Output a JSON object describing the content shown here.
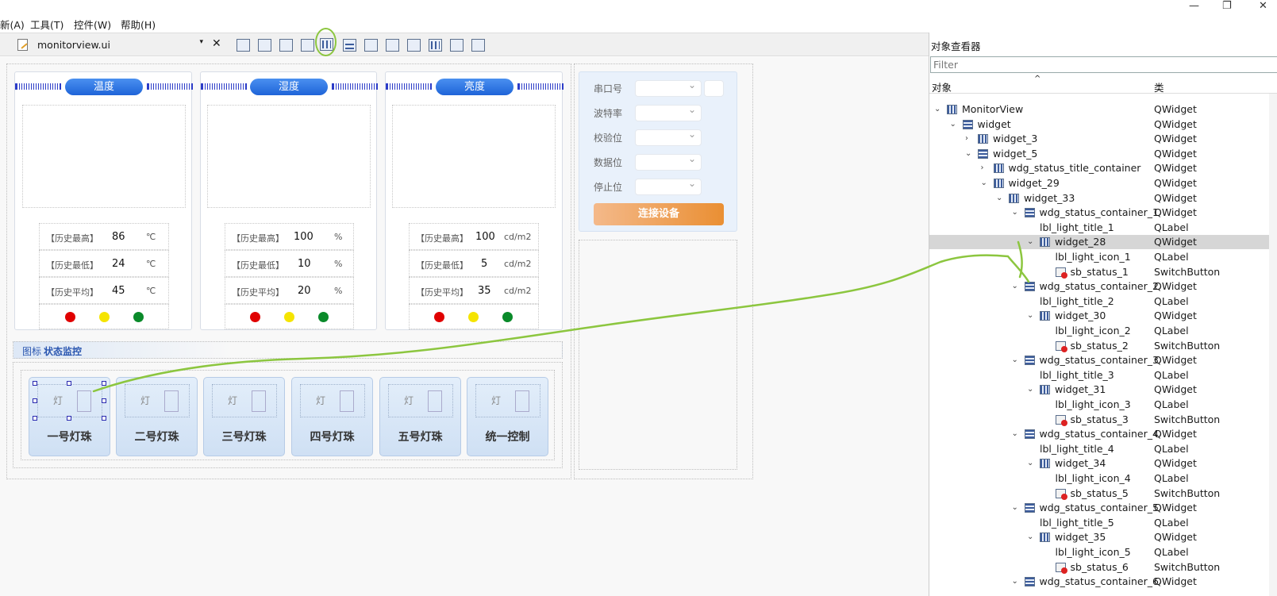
{
  "menu": {
    "items": [
      "新(A)",
      "工具(T)",
      "控件(W)",
      "帮助(H)"
    ]
  },
  "window_controls": {
    "minimize": "—",
    "restore": "❐",
    "close": "✕"
  },
  "toolbar": {
    "file_name": "monitorview.ui",
    "close_glyph": "✕",
    "dropdown_glyph": "▾"
  },
  "gauges": [
    {
      "title": "温度",
      "rows": [
        {
          "label": "【历史最高】",
          "value": "86",
          "unit": "℃"
        },
        {
          "label": "【历史最低】",
          "value": "24",
          "unit": "℃"
        },
        {
          "label": "【历史平均】",
          "value": "45",
          "unit": "℃"
        }
      ]
    },
    {
      "title": "湿度",
      "rows": [
        {
          "label": "【历史最高】",
          "value": "100",
          "unit": "%"
        },
        {
          "label": "【历史最低】",
          "value": "10",
          "unit": "%"
        },
        {
          "label": "【历史平均】",
          "value": "20",
          "unit": "%"
        }
      ]
    },
    {
      "title": "亮度",
      "rows": [
        {
          "label": "【历史最高】",
          "value": "100",
          "unit": "cd/m2"
        },
        {
          "label": "【历史最低】",
          "value": "5",
          "unit": "cd/m2"
        },
        {
          "label": "【历史平均】",
          "value": "35",
          "unit": "cd/m2"
        }
      ]
    }
  ],
  "status_colors": {
    "red": "#e00000",
    "yellow": "#f5e400",
    "green": "#0a8a2a"
  },
  "serial": {
    "fields": [
      "串口号",
      "波特率",
      "校验位",
      "数据位",
      "停止位"
    ],
    "connect_label": "连接设备"
  },
  "section": {
    "title_prefix": "图标",
    "title_main": "状态监控"
  },
  "lights": {
    "icon_text": "灯",
    "titles": [
      "一号灯珠",
      "二号灯珠",
      "三号灯珠",
      "四号灯珠",
      "五号灯珠",
      "统一控制"
    ]
  },
  "inspector": {
    "title": "对象查看器",
    "filter_placeholder": "Filter",
    "col_object": "对象",
    "col_class": "类",
    "tree": [
      {
        "name": "MonitorView",
        "cls": "QWidget",
        "icon": "h",
        "exp": "v"
      },
      {
        "name": "widget",
        "cls": "QWidget",
        "icon": "v",
        "exp": "v"
      },
      {
        "name": "widget_3",
        "cls": "QWidget",
        "icon": "h",
        "exp": ">"
      },
      {
        "name": "widget_5",
        "cls": "QWidget",
        "icon": "v",
        "exp": "v"
      },
      {
        "name": "wdg_status_title_container",
        "cls": "QWidget",
        "icon": "h",
        "exp": ">"
      },
      {
        "name": "widget_29",
        "cls": "QWidget",
        "icon": "h",
        "exp": "v"
      },
      {
        "name": "widget_33",
        "cls": "QWidget",
        "icon": "h",
        "exp": "v"
      },
      {
        "name": "wdg_status_container_1",
        "cls": "QWidget",
        "icon": "v",
        "exp": "v"
      },
      {
        "name": "lbl_light_title_1",
        "cls": "QLabel",
        "icon": "",
        "exp": ""
      },
      {
        "name": "widget_28",
        "cls": "QWidget",
        "icon": "h",
        "exp": "v",
        "sel": true
      },
      {
        "name": "lbl_light_icon_1",
        "cls": "QLabel",
        "icon": "",
        "exp": ""
      },
      {
        "name": "sb_status_1",
        "cls": "SwitchButton",
        "icon": "s",
        "exp": ""
      },
      {
        "name": "wdg_status_container_2",
        "cls": "QWidget",
        "icon": "v",
        "exp": "v"
      },
      {
        "name": "lbl_light_title_2",
        "cls": "QLabel",
        "icon": "",
        "exp": ""
      },
      {
        "name": "widget_30",
        "cls": "QWidget",
        "icon": "h",
        "exp": "v"
      },
      {
        "name": "lbl_light_icon_2",
        "cls": "QLabel",
        "icon": "",
        "exp": ""
      },
      {
        "name": "sb_status_2",
        "cls": "SwitchButton",
        "icon": "s",
        "exp": ""
      },
      {
        "name": "wdg_status_container_3",
        "cls": "QWidget",
        "icon": "v",
        "exp": "v"
      },
      {
        "name": "lbl_light_title_3",
        "cls": "QLabel",
        "icon": "",
        "exp": ""
      },
      {
        "name": "widget_31",
        "cls": "QWidget",
        "icon": "h",
        "exp": "v"
      },
      {
        "name": "lbl_light_icon_3",
        "cls": "QLabel",
        "icon": "",
        "exp": ""
      },
      {
        "name": "sb_status_3",
        "cls": "SwitchButton",
        "icon": "s",
        "exp": ""
      },
      {
        "name": "wdg_status_container_4",
        "cls": "QWidget",
        "icon": "v",
        "exp": "v"
      },
      {
        "name": "lbl_light_title_4",
        "cls": "QLabel",
        "icon": "",
        "exp": ""
      },
      {
        "name": "widget_34",
        "cls": "QWidget",
        "icon": "h",
        "exp": "v"
      },
      {
        "name": "lbl_light_icon_4",
        "cls": "QLabel",
        "icon": "",
        "exp": ""
      },
      {
        "name": "sb_status_5",
        "cls": "SwitchButton",
        "icon": "s",
        "exp": ""
      },
      {
        "name": "wdg_status_container_5",
        "cls": "QWidget",
        "icon": "v",
        "exp": "v"
      },
      {
        "name": "lbl_light_title_5",
        "cls": "QLabel",
        "icon": "",
        "exp": ""
      },
      {
        "name": "widget_35",
        "cls": "QWidget",
        "icon": "h",
        "exp": "v"
      },
      {
        "name": "lbl_light_icon_5",
        "cls": "QLabel",
        "icon": "",
        "exp": ""
      },
      {
        "name": "sb_status_6",
        "cls": "SwitchButton",
        "icon": "s",
        "exp": ""
      },
      {
        "name": "wdg_status_container_6",
        "cls": "QWidget",
        "icon": "v",
        "exp": "v"
      }
    ]
  }
}
